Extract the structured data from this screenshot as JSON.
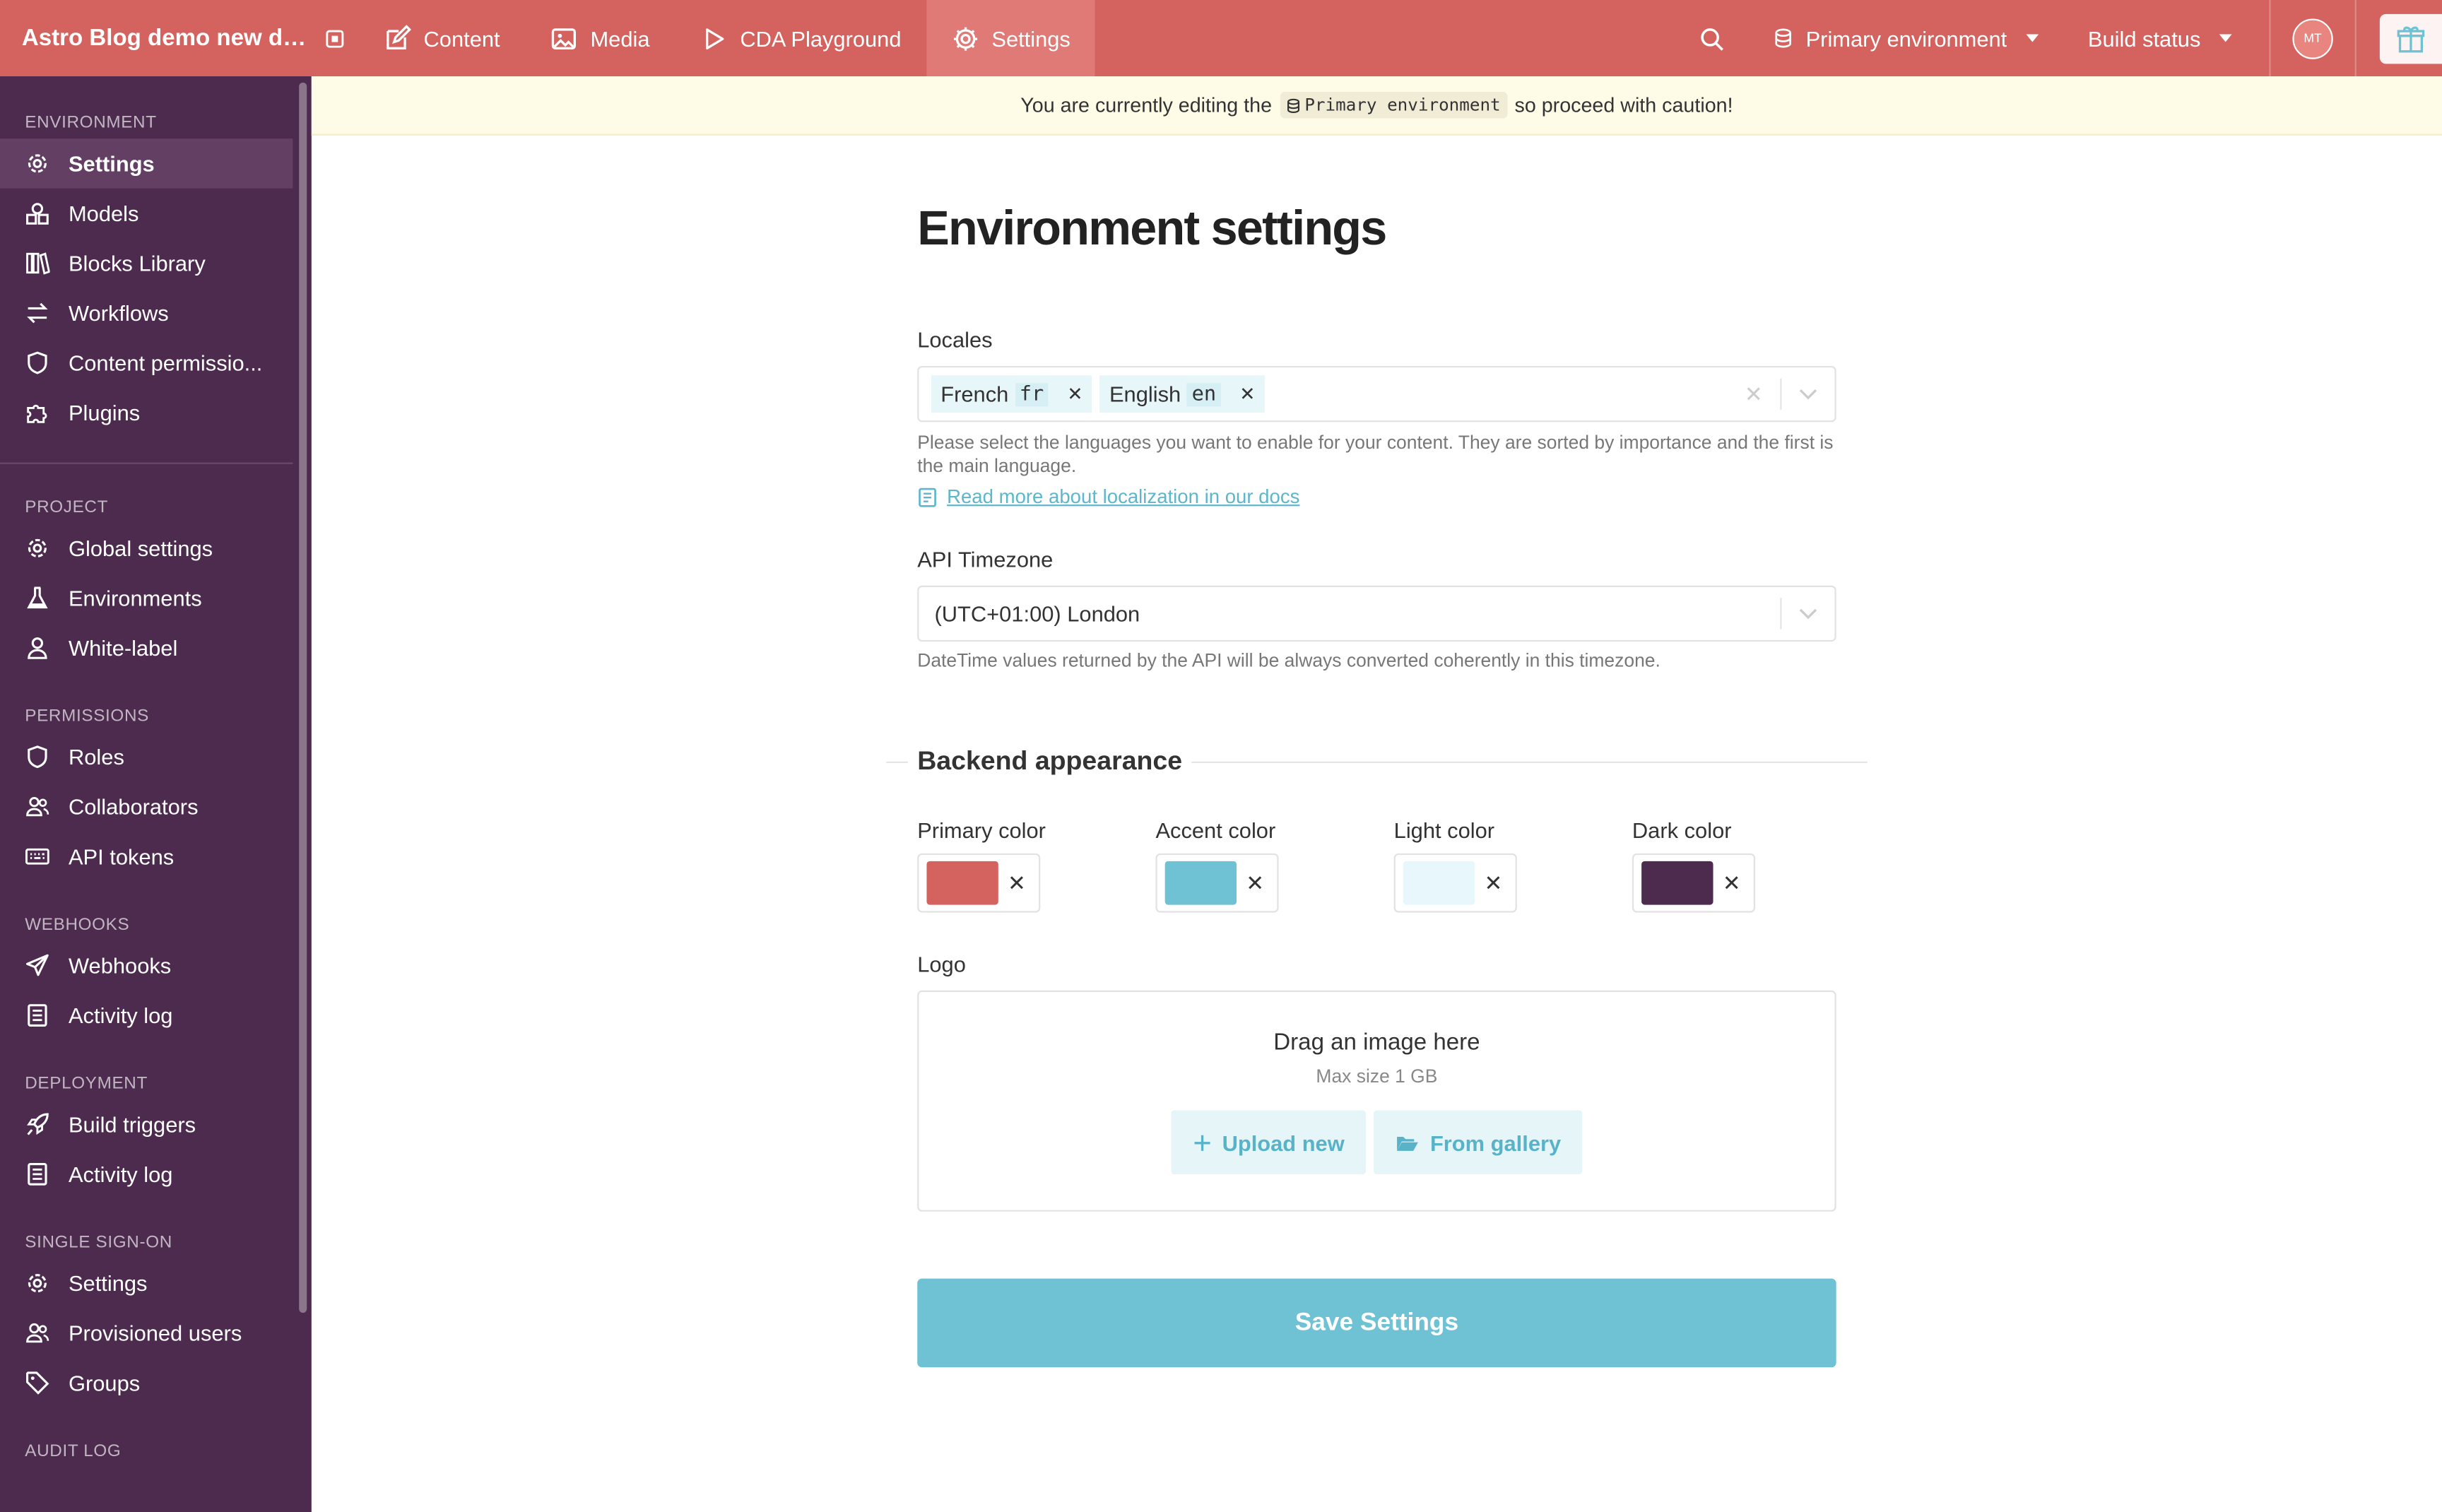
{
  "topbar": {
    "project_title": "Astro Blog demo new de...",
    "nav": [
      {
        "label": "Content",
        "icon": "edit-icon"
      },
      {
        "label": "Media",
        "icon": "image-icon"
      },
      {
        "label": "CDA Playground",
        "icon": "play-icon"
      },
      {
        "label": "Settings",
        "icon": "gear-icon",
        "active": true
      }
    ],
    "environment_label": "Primary environment",
    "build_status_label": "Build status",
    "avatar_initials": "MT"
  },
  "sidebar": {
    "sections": [
      {
        "title": "ENVIRONMENT",
        "items": [
          {
            "label": "Settings",
            "icon": "gear-icon",
            "active": true
          },
          {
            "label": "Models",
            "icon": "shapes-icon"
          },
          {
            "label": "Blocks Library",
            "icon": "books-icon"
          },
          {
            "label": "Workflows",
            "icon": "arrows-icon"
          },
          {
            "label": "Content permissio...",
            "icon": "shield-icon"
          },
          {
            "label": "Plugins",
            "icon": "puzzle-icon"
          }
        ]
      },
      {
        "title": "PROJECT",
        "items": [
          {
            "label": "Global settings",
            "icon": "gear-icon"
          },
          {
            "label": "Environments",
            "icon": "flask-icon"
          },
          {
            "label": "White-label",
            "icon": "user-tag-icon"
          }
        ]
      },
      {
        "title": "PERMISSIONS",
        "items": [
          {
            "label": "Roles",
            "icon": "shield-icon"
          },
          {
            "label": "Collaborators",
            "icon": "users-icon"
          },
          {
            "label": "API tokens",
            "icon": "keyboard-icon"
          }
        ]
      },
      {
        "title": "WEBHOOKS",
        "items": [
          {
            "label": "Webhooks",
            "icon": "paper-plane-icon"
          },
          {
            "label": "Activity log",
            "icon": "list-icon"
          }
        ]
      },
      {
        "title": "DEPLOYMENT",
        "items": [
          {
            "label": "Build triggers",
            "icon": "rocket-icon"
          },
          {
            "label": "Activity log",
            "icon": "list-icon"
          }
        ]
      },
      {
        "title": "SINGLE SIGN-ON",
        "items": [
          {
            "label": "Settings",
            "icon": "gear-icon"
          },
          {
            "label": "Provisioned users",
            "icon": "users-icon"
          },
          {
            "label": "Groups",
            "icon": "tag-icon"
          }
        ]
      },
      {
        "title": "AUDIT LOG",
        "items": []
      }
    ]
  },
  "banner": {
    "prefix": "You are currently editing the",
    "env_code": "Primary environment",
    "suffix": "so proceed with caution!"
  },
  "main": {
    "page_title": "Environment settings",
    "locales": {
      "label": "Locales",
      "chips": [
        {
          "name": "French",
          "code": "fr"
        },
        {
          "name": "English",
          "code": "en"
        }
      ],
      "hint": "Please select the languages you want to enable for your content. They are sorted by importance and the first is the main language.",
      "doc_link": "Read more about localization in our docs"
    },
    "timezone": {
      "label": "API Timezone",
      "value": "(UTC+01:00) London",
      "hint": "DateTime values returned by the API will be always converted coherently in this timezone."
    },
    "appearance": {
      "heading": "Backend appearance",
      "colors": [
        {
          "label": "Primary color",
          "value": "#d4635f"
        },
        {
          "label": "Accent color",
          "value": "#6ec2d4"
        },
        {
          "label": "Light color",
          "value": "#e8f7fb"
        },
        {
          "label": "Dark color",
          "value": "#4d2b4e"
        }
      ],
      "logo": {
        "label": "Logo",
        "drag_text": "Drag an image here",
        "max_size": "Max size 1 GB",
        "upload_label": "Upload new",
        "gallery_label": "From gallery"
      }
    },
    "save_label": "Save Settings"
  }
}
